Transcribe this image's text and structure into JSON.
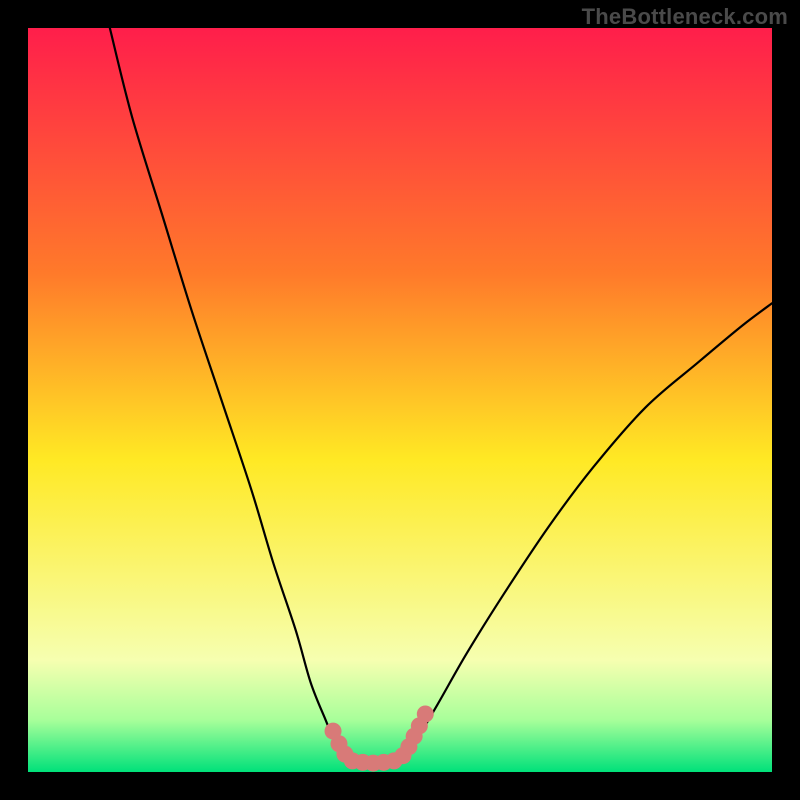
{
  "watermark": "TheBottleneck.com",
  "colors": {
    "background": "#000000",
    "gradient_top": "#ff1e4b",
    "gradient_mid_upper": "#ff7a2a",
    "gradient_mid": "#ffe924",
    "gradient_lower1": "#f6ffb0",
    "gradient_lower2": "#a8ff9a",
    "gradient_bottom": "#00e17a",
    "curve": "#000000",
    "marker": "#d87a78"
  },
  "chart_data": {
    "type": "line",
    "title": "",
    "xlabel": "",
    "ylabel": "",
    "xlim": [
      0,
      100
    ],
    "ylim": [
      0,
      100
    ],
    "series": [
      {
        "name": "left-curve",
        "x": [
          11,
          14,
          18,
          22,
          26,
          30,
          33,
          36,
          38,
          40,
          41.5,
          43
        ],
        "values": [
          100,
          88,
          75,
          62,
          50,
          38,
          28,
          19,
          12,
          7,
          3.5,
          1.5
        ]
      },
      {
        "name": "right-curve",
        "x": [
          50,
          52,
          55,
          59,
          64,
          70,
          76,
          83,
          90,
          96,
          100
        ],
        "values": [
          1.5,
          4,
          9,
          16,
          24,
          33,
          41,
          49,
          55,
          60,
          63
        ]
      },
      {
        "name": "floor",
        "x": [
          43,
          45,
          47,
          50
        ],
        "values": [
          1.5,
          1.2,
          1.2,
          1.5
        ]
      }
    ],
    "markers": [
      {
        "name": "left-cluster-top",
        "x": 41.0,
        "y": 5.5
      },
      {
        "name": "left-cluster-mid",
        "x": 41.8,
        "y": 3.8
      },
      {
        "name": "left-cluster-low",
        "x": 42.6,
        "y": 2.4
      },
      {
        "name": "floor-1",
        "x": 43.6,
        "y": 1.5
      },
      {
        "name": "floor-2",
        "x": 45.0,
        "y": 1.3
      },
      {
        "name": "floor-3",
        "x": 46.4,
        "y": 1.2
      },
      {
        "name": "floor-4",
        "x": 47.8,
        "y": 1.3
      },
      {
        "name": "floor-5",
        "x": 49.2,
        "y": 1.5
      },
      {
        "name": "right-cluster-1",
        "x": 50.4,
        "y": 2.2
      },
      {
        "name": "right-cluster-2",
        "x": 51.2,
        "y": 3.4
      },
      {
        "name": "right-cluster-3",
        "x": 51.9,
        "y": 4.8
      },
      {
        "name": "right-cluster-4",
        "x": 52.6,
        "y": 6.2
      },
      {
        "name": "right-cluster-top",
        "x": 53.4,
        "y": 7.8
      }
    ]
  }
}
